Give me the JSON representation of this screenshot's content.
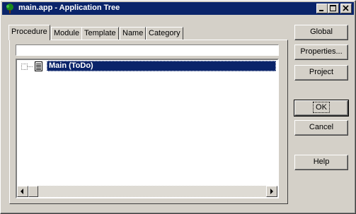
{
  "window": {
    "title": "main.app - Application Tree"
  },
  "tabs": [
    {
      "label": "Procedure",
      "active": true
    },
    {
      "label": "Module",
      "active": false
    },
    {
      "label": "Template",
      "active": false
    },
    {
      "label": "Name",
      "active": false
    },
    {
      "label": "Category",
      "active": false
    }
  ],
  "filter": {
    "value": ""
  },
  "tree": {
    "items": [
      {
        "label": "Main (ToDo)",
        "selected": true
      }
    ]
  },
  "buttons": {
    "global": "Global",
    "properties": "Properties...",
    "project": "Project",
    "ok": "OK",
    "cancel": "Cancel",
    "help": "Help"
  },
  "colors": {
    "face": "#d4d0c8",
    "titlebar": "#0a246a",
    "selection": "#0a246a"
  }
}
